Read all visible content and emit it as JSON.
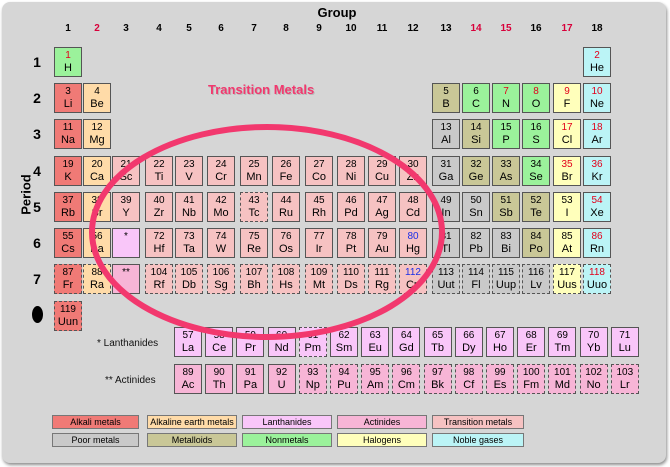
{
  "header": {
    "group_label": "Group",
    "period_label": "Period"
  },
  "group_numbers": [
    "1",
    "2",
    "3",
    "4",
    "5",
    "6",
    "7",
    "8",
    "9",
    "10",
    "11",
    "12",
    "13",
    "14",
    "15",
    "16",
    "17",
    "18"
  ],
  "period_numbers": [
    "1",
    "2",
    "3",
    "4",
    "5",
    "6",
    "7"
  ],
  "annotation": {
    "label": "Transition Metals",
    "color": "#f2386e"
  },
  "row_labels": {
    "lanthanides": "* Lanthanides",
    "actinides": "** Actinides"
  },
  "colors": {
    "alkali": "#f07a76",
    "alkaline": "#ffdba8",
    "lanth": "#f9c6f9",
    "actin": "#f7b5d6",
    "trans": "#f6c2c2",
    "poor": "#c9c9c9",
    "metalloid": "#c9c797",
    "nonmetal": "#9bf29b",
    "halogen": "#ffffbb",
    "noble": "#bbf4f6"
  },
  "elements": [
    {
      "n": "1",
      "s": "H",
      "g": 1,
      "p": 1,
      "c": "nonmetal",
      "nc": "red"
    },
    {
      "n": "2",
      "s": "He",
      "g": 18,
      "p": 1,
      "c": "noble",
      "nc": "red"
    },
    {
      "n": "3",
      "s": "Li",
      "g": 1,
      "p": 2,
      "c": "alkali"
    },
    {
      "n": "4",
      "s": "Be",
      "g": 2,
      "p": 2,
      "c": "alkaline"
    },
    {
      "n": "5",
      "s": "B",
      "g": 13,
      "p": 2,
      "c": "metalloid"
    },
    {
      "n": "6",
      "s": "C",
      "g": 14,
      "p": 2,
      "c": "nonmetal"
    },
    {
      "n": "7",
      "s": "N",
      "g": 15,
      "p": 2,
      "c": "nonmetal",
      "nc": "red"
    },
    {
      "n": "8",
      "s": "O",
      "g": 16,
      "p": 2,
      "c": "nonmetal",
      "nc": "red"
    },
    {
      "n": "9",
      "s": "F",
      "g": 17,
      "p": 2,
      "c": "halogen",
      "nc": "red"
    },
    {
      "n": "10",
      "s": "Ne",
      "g": 18,
      "p": 2,
      "c": "noble",
      "nc": "red"
    },
    {
      "n": "11",
      "s": "Na",
      "g": 1,
      "p": 3,
      "c": "alkali"
    },
    {
      "n": "12",
      "s": "Mg",
      "g": 2,
      "p": 3,
      "c": "alkaline"
    },
    {
      "n": "13",
      "s": "Al",
      "g": 13,
      "p": 3,
      "c": "poor"
    },
    {
      "n": "14",
      "s": "Si",
      "g": 14,
      "p": 3,
      "c": "metalloid"
    },
    {
      "n": "15",
      "s": "P",
      "g": 15,
      "p": 3,
      "c": "nonmetal"
    },
    {
      "n": "16",
      "s": "S",
      "g": 16,
      "p": 3,
      "c": "nonmetal"
    },
    {
      "n": "17",
      "s": "Cl",
      "g": 17,
      "p": 3,
      "c": "halogen",
      "nc": "red"
    },
    {
      "n": "18",
      "s": "Ar",
      "g": 18,
      "p": 3,
      "c": "noble",
      "nc": "red"
    },
    {
      "n": "19",
      "s": "K",
      "g": 1,
      "p": 4,
      "c": "alkali"
    },
    {
      "n": "20",
      "s": "Ca",
      "g": 2,
      "p": 4,
      "c": "alkaline"
    },
    {
      "n": "21",
      "s": "Sc",
      "g": 3,
      "p": 4,
      "c": "trans"
    },
    {
      "n": "22",
      "s": "Ti",
      "g": 4,
      "p": 4,
      "c": "trans"
    },
    {
      "n": "23",
      "s": "V",
      "g": 5,
      "p": 4,
      "c": "trans"
    },
    {
      "n": "24",
      "s": "Cr",
      "g": 6,
      "p": 4,
      "c": "trans"
    },
    {
      "n": "25",
      "s": "Mn",
      "g": 7,
      "p": 4,
      "c": "trans"
    },
    {
      "n": "26",
      "s": "Fe",
      "g": 8,
      "p": 4,
      "c": "trans"
    },
    {
      "n": "27",
      "s": "Co",
      "g": 9,
      "p": 4,
      "c": "trans"
    },
    {
      "n": "28",
      "s": "Ni",
      "g": 10,
      "p": 4,
      "c": "trans"
    },
    {
      "n": "29",
      "s": "Cu",
      "g": 11,
      "p": 4,
      "c": "trans"
    },
    {
      "n": "30",
      "s": "Zn",
      "g": 12,
      "p": 4,
      "c": "trans"
    },
    {
      "n": "31",
      "s": "Ga",
      "g": 13,
      "p": 4,
      "c": "poor"
    },
    {
      "n": "32",
      "s": "Ge",
      "g": 14,
      "p": 4,
      "c": "metalloid"
    },
    {
      "n": "33",
      "s": "As",
      "g": 15,
      "p": 4,
      "c": "metalloid"
    },
    {
      "n": "34",
      "s": "Se",
      "g": 16,
      "p": 4,
      "c": "nonmetal"
    },
    {
      "n": "35",
      "s": "Br",
      "g": 17,
      "p": 4,
      "c": "halogen",
      "nc": "red"
    },
    {
      "n": "36",
      "s": "Kr",
      "g": 18,
      "p": 4,
      "c": "noble",
      "nc": "red"
    },
    {
      "n": "37",
      "s": "Rb",
      "g": 1,
      "p": 5,
      "c": "alkali"
    },
    {
      "n": "38",
      "s": "Sr",
      "g": 2,
      "p": 5,
      "c": "alkaline"
    },
    {
      "n": "39",
      "s": "Y",
      "g": 3,
      "p": 5,
      "c": "trans"
    },
    {
      "n": "40",
      "s": "Zr",
      "g": 4,
      "p": 5,
      "c": "trans"
    },
    {
      "n": "41",
      "s": "Nb",
      "g": 5,
      "p": 5,
      "c": "trans"
    },
    {
      "n": "42",
      "s": "Mo",
      "g": 6,
      "p": 5,
      "c": "trans"
    },
    {
      "n": "43",
      "s": "Tc",
      "g": 7,
      "p": 5,
      "c": "trans",
      "d": true
    },
    {
      "n": "44",
      "s": "Ru",
      "g": 8,
      "p": 5,
      "c": "trans"
    },
    {
      "n": "45",
      "s": "Rh",
      "g": 9,
      "p": 5,
      "c": "trans"
    },
    {
      "n": "46",
      "s": "Pd",
      "g": 10,
      "p": 5,
      "c": "trans"
    },
    {
      "n": "47",
      "s": "Ag",
      "g": 11,
      "p": 5,
      "c": "trans"
    },
    {
      "n": "48",
      "s": "Cd",
      "g": 12,
      "p": 5,
      "c": "trans"
    },
    {
      "n": "49",
      "s": "In",
      "g": 13,
      "p": 5,
      "c": "poor"
    },
    {
      "n": "50",
      "s": "Sn",
      "g": 14,
      "p": 5,
      "c": "poor"
    },
    {
      "n": "51",
      "s": "Sb",
      "g": 15,
      "p": 5,
      "c": "metalloid"
    },
    {
      "n": "52",
      "s": "Te",
      "g": 16,
      "p": 5,
      "c": "metalloid"
    },
    {
      "n": "53",
      "s": "I",
      "g": 17,
      "p": 5,
      "c": "halogen"
    },
    {
      "n": "54",
      "s": "Xe",
      "g": 18,
      "p": 5,
      "c": "noble",
      "nc": "red"
    },
    {
      "n": "55",
      "s": "Cs",
      "g": 1,
      "p": 6,
      "c": "alkali"
    },
    {
      "n": "56",
      "s": "Ba",
      "g": 2,
      "p": 6,
      "c": "alkaline"
    },
    {
      "n": "*",
      "s": "",
      "g": 3,
      "p": 6,
      "c": "lanth",
      "star": true
    },
    {
      "n": "72",
      "s": "Hf",
      "g": 4,
      "p": 6,
      "c": "trans"
    },
    {
      "n": "73",
      "s": "Ta",
      "g": 5,
      "p": 6,
      "c": "trans"
    },
    {
      "n": "74",
      "s": "W",
      "g": 6,
      "p": 6,
      "c": "trans"
    },
    {
      "n": "75",
      "s": "Re",
      "g": 7,
      "p": 6,
      "c": "trans"
    },
    {
      "n": "76",
      "s": "Os",
      "g": 8,
      "p": 6,
      "c": "trans"
    },
    {
      "n": "77",
      "s": "Ir",
      "g": 9,
      "p": 6,
      "c": "trans"
    },
    {
      "n": "78",
      "s": "Pt",
      "g": 10,
      "p": 6,
      "c": "trans"
    },
    {
      "n": "79",
      "s": "Au",
      "g": 11,
      "p": 6,
      "c": "trans"
    },
    {
      "n": "80",
      "s": "Hg",
      "g": 12,
      "p": 6,
      "c": "trans",
      "nc": "blue"
    },
    {
      "n": "81",
      "s": "Tl",
      "g": 13,
      "p": 6,
      "c": "poor"
    },
    {
      "n": "82",
      "s": "Pb",
      "g": 14,
      "p": 6,
      "c": "poor"
    },
    {
      "n": "83",
      "s": "Bi",
      "g": 15,
      "p": 6,
      "c": "poor"
    },
    {
      "n": "84",
      "s": "Po",
      "g": 16,
      "p": 6,
      "c": "metalloid"
    },
    {
      "n": "85",
      "s": "At",
      "g": 17,
      "p": 6,
      "c": "halogen"
    },
    {
      "n": "86",
      "s": "Rn",
      "g": 18,
      "p": 6,
      "c": "noble",
      "nc": "red"
    },
    {
      "n": "87",
      "s": "Fr",
      "g": 1,
      "p": 7,
      "c": "alkali",
      "d": true
    },
    {
      "n": "88",
      "s": "Ra",
      "g": 2,
      "p": 7,
      "c": "alkaline",
      "d": true
    },
    {
      "n": "**",
      "s": "",
      "g": 3,
      "p": 7,
      "c": "actin",
      "star": true
    },
    {
      "n": "104",
      "s": "Rf",
      "g": 4,
      "p": 7,
      "c": "trans",
      "d": true
    },
    {
      "n": "105",
      "s": "Db",
      "g": 5,
      "p": 7,
      "c": "trans",
      "d": true
    },
    {
      "n": "106",
      "s": "Sg",
      "g": 6,
      "p": 7,
      "c": "trans",
      "d": true
    },
    {
      "n": "107",
      "s": "Bh",
      "g": 7,
      "p": 7,
      "c": "trans",
      "d": true
    },
    {
      "n": "108",
      "s": "Hs",
      "g": 8,
      "p": 7,
      "c": "trans",
      "d": true
    },
    {
      "n": "109",
      "s": "Mt",
      "g": 9,
      "p": 7,
      "c": "trans",
      "d": true
    },
    {
      "n": "110",
      "s": "Ds",
      "g": 10,
      "p": 7,
      "c": "trans",
      "d": true
    },
    {
      "n": "111",
      "s": "Rg",
      "g": 11,
      "p": 7,
      "c": "trans",
      "d": true
    },
    {
      "n": "112",
      "s": "Cn",
      "g": 12,
      "p": 7,
      "c": "trans",
      "d": true,
      "nc": "blue"
    },
    {
      "n": "113",
      "s": "Uut",
      "g": 13,
      "p": 7,
      "c": "poor",
      "d": true
    },
    {
      "n": "114",
      "s": "Fl",
      "g": 14,
      "p": 7,
      "c": "poor",
      "d": true
    },
    {
      "n": "115",
      "s": "Uup",
      "g": 15,
      "p": 7,
      "c": "poor",
      "d": true
    },
    {
      "n": "116",
      "s": "Lv",
      "g": 16,
      "p": 7,
      "c": "poor",
      "d": true
    },
    {
      "n": "117",
      "s": "Uus",
      "g": 17,
      "p": 7,
      "c": "halogen",
      "d": true
    },
    {
      "n": "118",
      "s": "Uuo",
      "g": 18,
      "p": 7,
      "c": "noble",
      "d": true,
      "nc": "red"
    },
    {
      "n": "119",
      "s": "Uun",
      "g": 1,
      "p": 8,
      "c": "alkali",
      "d": true
    }
  ],
  "lanthanides": [
    {
      "n": "57",
      "s": "La"
    },
    {
      "n": "58",
      "s": "Ce"
    },
    {
      "n": "59",
      "s": "Pr"
    },
    {
      "n": "60",
      "s": "Nd"
    },
    {
      "n": "61",
      "s": "Pm",
      "d": true
    },
    {
      "n": "62",
      "s": "Sm"
    },
    {
      "n": "63",
      "s": "Eu"
    },
    {
      "n": "64",
      "s": "Gd"
    },
    {
      "n": "65",
      "s": "Tb"
    },
    {
      "n": "66",
      "s": "Dy"
    },
    {
      "n": "67",
      "s": "Ho"
    },
    {
      "n": "68",
      "s": "Er"
    },
    {
      "n": "69",
      "s": "Tm"
    },
    {
      "n": "70",
      "s": "Yb"
    },
    {
      "n": "71",
      "s": "Lu"
    }
  ],
  "actinides": [
    {
      "n": "89",
      "s": "Ac"
    },
    {
      "n": "90",
      "s": "Th"
    },
    {
      "n": "91",
      "s": "Pa"
    },
    {
      "n": "92",
      "s": "U"
    },
    {
      "n": "93",
      "s": "Np",
      "d": true
    },
    {
      "n": "94",
      "s": "Pu",
      "d": true
    },
    {
      "n": "95",
      "s": "Am",
      "d": true
    },
    {
      "n": "96",
      "s": "Cm",
      "d": true
    },
    {
      "n": "97",
      "s": "Bk",
      "d": true
    },
    {
      "n": "98",
      "s": "Cf",
      "d": true
    },
    {
      "n": "99",
      "s": "Es",
      "d": true
    },
    {
      "n": "100",
      "s": "Fm",
      "d": true
    },
    {
      "n": "101",
      "s": "Md",
      "d": true
    },
    {
      "n": "102",
      "s": "No",
      "d": true
    },
    {
      "n": "103",
      "s": "Lr",
      "d": true
    }
  ],
  "legend_rows": [
    [
      {
        "label": "Alkali metals",
        "c": "alkali"
      },
      {
        "label": "Alkaline earth metals",
        "c": "alkaline"
      },
      {
        "label": "Lanthanides",
        "c": "lanth"
      },
      {
        "label": "Actinides",
        "c": "actin"
      },
      {
        "label": "Transition metals",
        "c": "trans"
      }
    ],
    [
      {
        "label": "Poor metals",
        "c": "poor"
      },
      {
        "label": "Metalloids",
        "c": "metalloid"
      },
      {
        "label": "Nonmetals",
        "c": "nonmetal"
      },
      {
        "label": "Halogens",
        "c": "halogen"
      },
      {
        "label": "Noble gases",
        "c": "noble"
      }
    ]
  ]
}
